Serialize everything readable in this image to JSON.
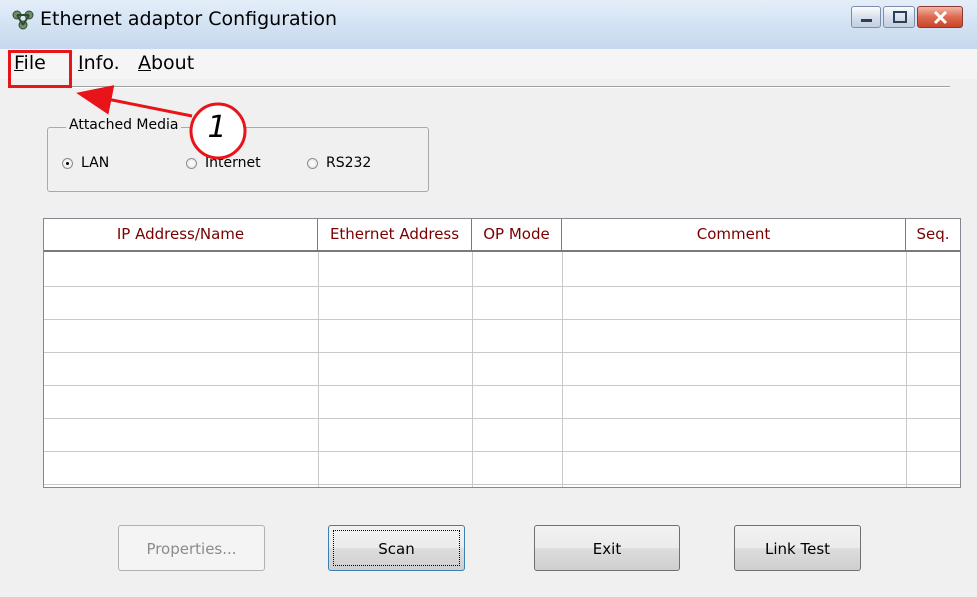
{
  "window": {
    "title": "Ethernet adaptor Configuration",
    "icons": {
      "app": "network-adaptor-icon",
      "minimize": "minimize-icon",
      "maximize": "maximize-icon",
      "close": "close-icon"
    }
  },
  "menu": {
    "items": [
      {
        "label": "File",
        "accel": "F",
        "rest": "ile"
      },
      {
        "label": "Info.",
        "accel": "I",
        "rest": "nfo."
      },
      {
        "label": "About",
        "accel": "A",
        "rest": "bout"
      }
    ]
  },
  "attached_media": {
    "legend": "Attached Media",
    "options": [
      {
        "label": "LAN",
        "selected": true
      },
      {
        "label": "Internet",
        "selected": false
      },
      {
        "label": "RS232",
        "selected": false
      }
    ]
  },
  "table": {
    "columns": [
      "IP Address/Name",
      "Ethernet Address",
      "OP Mode",
      "Comment",
      "Seq."
    ],
    "rows": []
  },
  "buttons": {
    "properties": "Properties...",
    "scan": "Scan",
    "exit": "Exit",
    "link_test": "Link Test"
  },
  "annotation": {
    "number": "1",
    "color": "#e8141a"
  },
  "colors": {
    "header_text": "#7a0000",
    "titlebar": "#d5e4f4"
  }
}
